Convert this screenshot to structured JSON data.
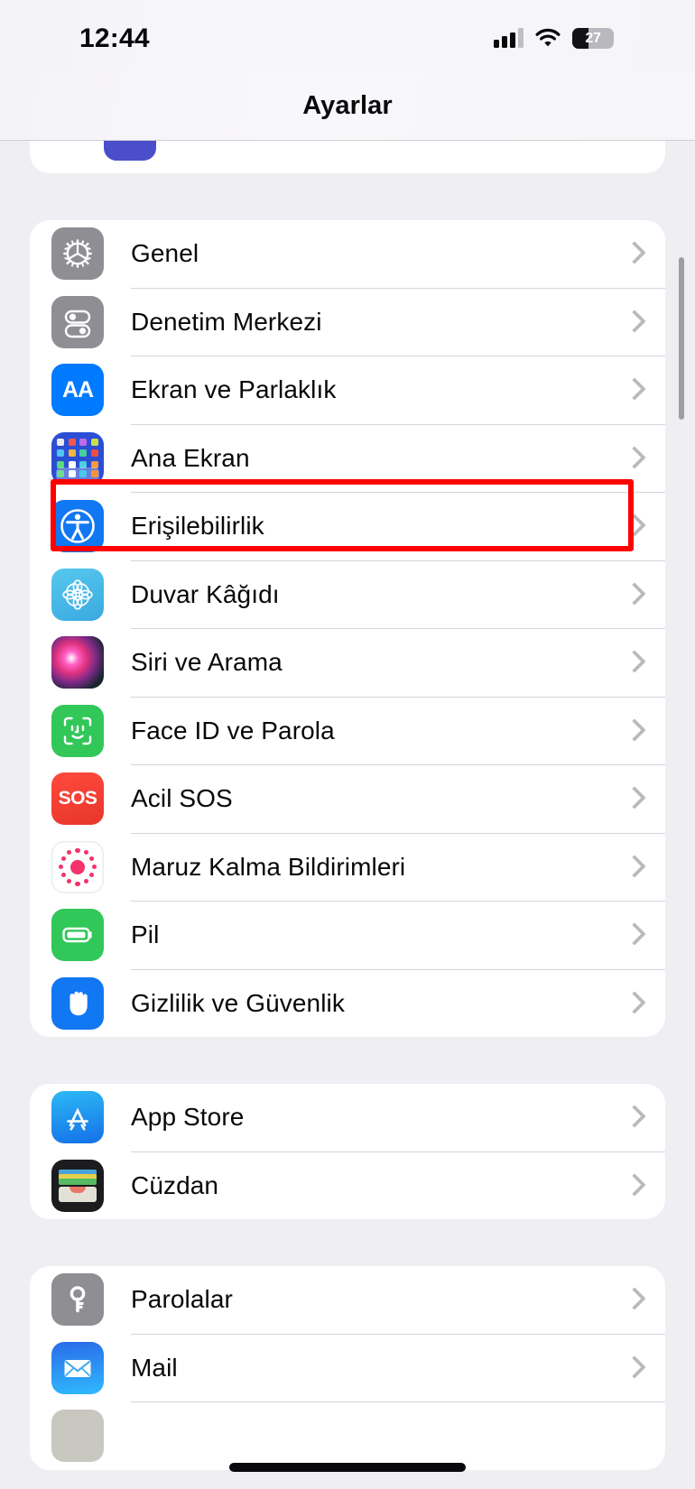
{
  "status_bar": {
    "time": "12:44",
    "signal_icon": "cellular-bars-icon",
    "wifi_icon": "wifi-icon",
    "battery_percent": "27",
    "battery_icon": "battery-icon"
  },
  "nav": {
    "title": "Ayarlar"
  },
  "highlight": {
    "color": "#ff0000",
    "target_row": "Erişilebilirlik"
  },
  "groups": [
    {
      "id": "group-cut-top",
      "partial": true,
      "rows": []
    },
    {
      "id": "group-system",
      "rows": [
        {
          "label": "Genel",
          "icon": "gear-icon"
        },
        {
          "label": "Denetim Merkezi",
          "icon": "control-center-icon"
        },
        {
          "label": "Ekran ve Parlaklık",
          "icon": "display-brightness-icon"
        },
        {
          "label": "Ana Ekran",
          "icon": "home-screen-icon"
        },
        {
          "label": "Erişilebilirlik",
          "icon": "accessibility-icon"
        },
        {
          "label": "Duvar Kâğıdı",
          "icon": "wallpaper-icon"
        },
        {
          "label": "Siri ve Arama",
          "icon": "siri-icon"
        },
        {
          "label": "Face ID ve Parola",
          "icon": "face-id-icon"
        },
        {
          "label": "Acil SOS",
          "icon": "emergency-sos-icon"
        },
        {
          "label": "Maruz Kalma Bildirimleri",
          "icon": "exposure-notifications-icon"
        },
        {
          "label": "Pil",
          "icon": "battery-settings-icon"
        },
        {
          "label": "Gizlilik ve Güvenlik",
          "icon": "privacy-hand-icon"
        }
      ]
    },
    {
      "id": "group-store",
      "rows": [
        {
          "label": "App Store",
          "icon": "app-store-icon"
        },
        {
          "label": "Cüzdan",
          "icon": "wallet-icon"
        }
      ]
    },
    {
      "id": "group-accounts",
      "rows": [
        {
          "label": "Parolalar",
          "icon": "passwords-key-icon"
        },
        {
          "label": "Mail",
          "icon": "mail-icon"
        }
      ]
    }
  ],
  "scrollbar": {
    "name": "vertical-scrollbar"
  },
  "home_indicator": {
    "name": "home-indicator"
  }
}
